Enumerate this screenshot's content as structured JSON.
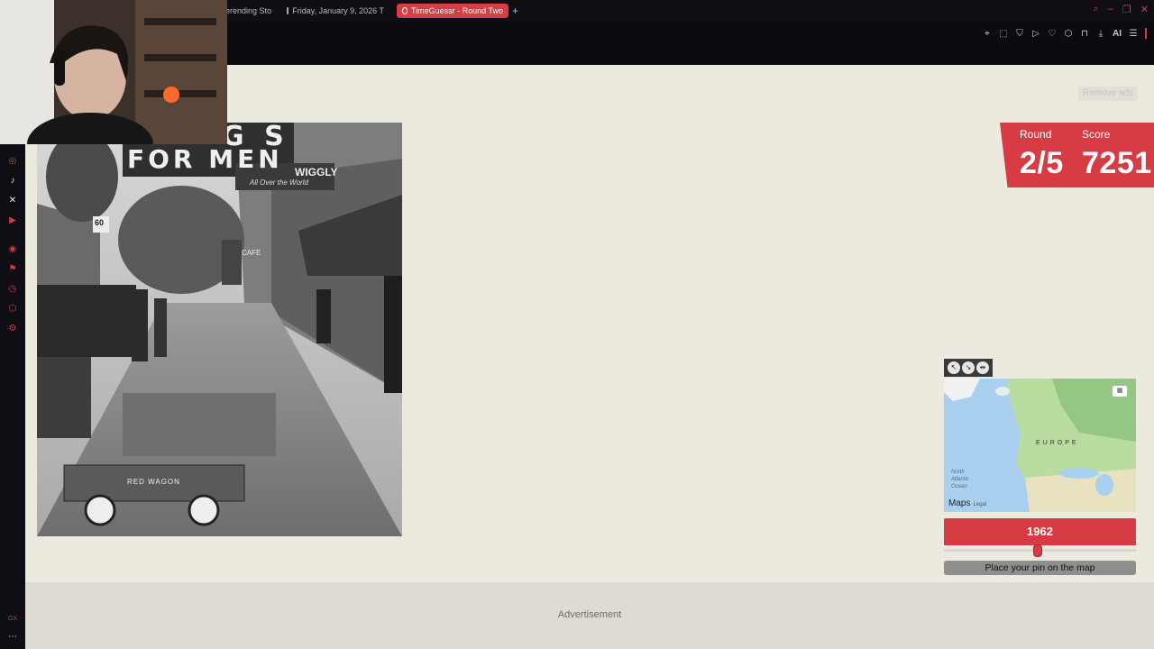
{
  "browser": {
    "tabs": [
      {
        "label": "erending Sto",
        "active": false
      },
      {
        "label": "Friday, January 9, 2026 T",
        "active": false
      },
      {
        "label": "TimeGuessr - Round Two",
        "active": true
      }
    ],
    "toolbar_ai_label": "AI"
  },
  "page": {
    "remove_ads_label": "Remove ads",
    "advertisement_label": "Advertisement"
  },
  "photo": {
    "sign_top": "G S",
    "sign_main": "FOR MEN",
    "sign_wiggly": "WIGGLY",
    "sign_wiggly_sub": "All Over the World",
    "sign_route": "60",
    "sign_cafe": "CAFE",
    "wagon_label": "RED WAGON"
  },
  "scoreboard": {
    "round_label": "Round",
    "round_value": "2/5",
    "score_label": "Score",
    "score_value": "7251"
  },
  "map": {
    "region_label": "EUROPE",
    "ocean_label": [
      "North",
      "Atlantic",
      "Ocean"
    ],
    "attribution": "Maps",
    "legal": "Legal"
  },
  "year_guess": {
    "value": "1962",
    "slider_fraction": 0.49
  },
  "place_pin_label": "Place your pin on the map",
  "colors": {
    "accent": "#d63c44",
    "page_bg": "#eceadf"
  }
}
